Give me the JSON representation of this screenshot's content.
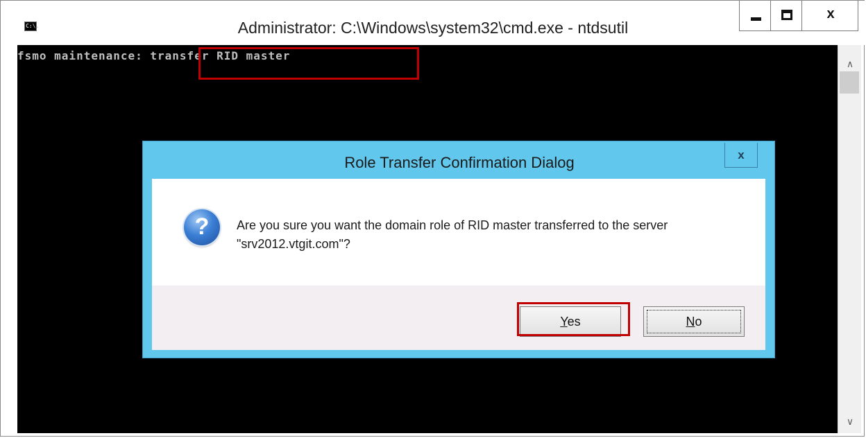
{
  "window": {
    "title": "Administrator: C:\\Windows\\system32\\cmd.exe - ntdsutil",
    "icon": "cmd-icon",
    "icon_text": "C:\\.",
    "close_label": "x"
  },
  "console": {
    "prompt": "fsmo maintenance: ",
    "command": "transfer RID master",
    "background": "#000000",
    "text_color": "#c0c0c0"
  },
  "dialog": {
    "title": "Role Transfer Confirmation Dialog",
    "close_label": "x",
    "icon": "question-icon",
    "icon_text": "?",
    "message": "Are you sure you want the domain role of RID master transferred to the server \"srv2012.vtgit.com\"?",
    "yes_label_hotkey": "Y",
    "yes_label_rest": "es",
    "no_label_hotkey": "N",
    "no_label_rest": "o",
    "title_color": "#62c7ec"
  },
  "annotations": {
    "highlight_color": "#c00000"
  }
}
